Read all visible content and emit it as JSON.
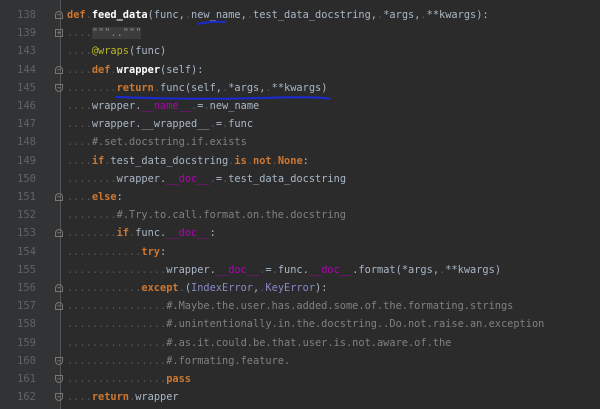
{
  "editor": {
    "colors": {
      "background": "#2b2b2b",
      "keyword": "#cc7832",
      "decorator": "#bbb529",
      "dunder": "#b200b2",
      "comment": "#808080",
      "builtin_class": "#8888c6",
      "annotation": "#1a2bd6"
    },
    "lines": [
      {
        "num": "138",
        "fold": "minus",
        "tokens": [
          [
            "kw",
            "def"
          ],
          [
            "ws",
            "."
          ],
          [
            "fn",
            "feed_data"
          ],
          [
            "tx",
            "(func,"
          ],
          [
            "ws",
            "."
          ],
          [
            "tx",
            "new_name,"
          ],
          [
            "ws",
            "."
          ],
          [
            "tx",
            "test_data_docstring,"
          ],
          [
            "ws",
            "."
          ],
          [
            "tx",
            "*args,"
          ],
          [
            "ws",
            "."
          ],
          [
            "tx",
            "**kwargs):"
          ]
        ]
      },
      {
        "num": "139",
        "fold": "plus",
        "tokens": [
          [
            "ws",
            "...."
          ],
          [
            "fold",
            "\"\"\"..\"\"\""
          ]
        ]
      },
      {
        "num": "143",
        "fold": "",
        "tokens": [
          [
            "ws",
            "...."
          ],
          [
            "dec",
            "@wraps"
          ],
          [
            "tx",
            "(func)"
          ]
        ]
      },
      {
        "num": "144",
        "fold": "minus",
        "tokens": [
          [
            "ws",
            "...."
          ],
          [
            "kw",
            "def"
          ],
          [
            "ws",
            "."
          ],
          [
            "fn",
            "wrapper"
          ],
          [
            "tx",
            "(self):"
          ]
        ]
      },
      {
        "num": "145",
        "fold": "end",
        "tokens": [
          [
            "ws",
            "........"
          ],
          [
            "kw",
            "return"
          ],
          [
            "ws",
            "."
          ],
          [
            "tx",
            "func(self,"
          ],
          [
            "ws",
            "."
          ],
          [
            "tx",
            "*args,"
          ],
          [
            "ws",
            "."
          ],
          [
            "tx",
            "**kwargs)"
          ]
        ]
      },
      {
        "num": "146",
        "fold": "",
        "tokens": [
          [
            "ws",
            "...."
          ],
          [
            "tx",
            "wrapper."
          ],
          [
            "dun",
            "__name__"
          ],
          [
            "ws",
            "."
          ],
          [
            "tx",
            "="
          ],
          [
            "ws",
            "."
          ],
          [
            "tx",
            "new_name"
          ]
        ]
      },
      {
        "num": "147",
        "fold": "",
        "tokens": [
          [
            "ws",
            "...."
          ],
          [
            "tx",
            "wrapper.__wrapped__"
          ],
          [
            "ws",
            "."
          ],
          [
            "tx",
            "="
          ],
          [
            "ws",
            "."
          ],
          [
            "tx",
            "func"
          ]
        ]
      },
      {
        "num": "148",
        "fold": "",
        "tokens": [
          [
            "ws",
            "...."
          ],
          [
            "cm",
            "#.set.docstring.if.exists"
          ]
        ]
      },
      {
        "num": "149",
        "fold": "",
        "tokens": [
          [
            "ws",
            "...."
          ],
          [
            "kw",
            "if"
          ],
          [
            "ws",
            "."
          ],
          [
            "tx",
            "test_data_docstring"
          ],
          [
            "ws",
            "."
          ],
          [
            "kw",
            "is"
          ],
          [
            "ws",
            "."
          ],
          [
            "kw",
            "not"
          ],
          [
            "ws",
            "."
          ],
          [
            "kw",
            "None"
          ],
          [
            "tx",
            ":"
          ]
        ]
      },
      {
        "num": "150",
        "fold": "",
        "tokens": [
          [
            "ws",
            "........"
          ],
          [
            "tx",
            "wrapper."
          ],
          [
            "dun",
            "__doc__"
          ],
          [
            "ws",
            "."
          ],
          [
            "tx",
            "="
          ],
          [
            "ws",
            "."
          ],
          [
            "tx",
            "test_data_docstring"
          ]
        ]
      },
      {
        "num": "151",
        "fold": "minus",
        "tokens": [
          [
            "ws",
            "...."
          ],
          [
            "kw",
            "else"
          ],
          [
            "tx",
            ":"
          ]
        ]
      },
      {
        "num": "152",
        "fold": "",
        "tokens": [
          [
            "ws",
            "........"
          ],
          [
            "cm",
            "#.Try.to.call.format.on.the.docstring"
          ]
        ]
      },
      {
        "num": "153",
        "fold": "minus",
        "tokens": [
          [
            "ws",
            "........"
          ],
          [
            "kw",
            "if"
          ],
          [
            "ws",
            "."
          ],
          [
            "tx",
            "func."
          ],
          [
            "dun",
            "__doc__"
          ],
          [
            "tx",
            ":"
          ]
        ]
      },
      {
        "num": "154",
        "fold": "",
        "tokens": [
          [
            "ws",
            "............"
          ],
          [
            "kw",
            "try"
          ],
          [
            "tx",
            ":"
          ]
        ]
      },
      {
        "num": "155",
        "fold": "",
        "tokens": [
          [
            "ws",
            "................"
          ],
          [
            "tx",
            "wrapper."
          ],
          [
            "dun",
            "__doc__"
          ],
          [
            "ws",
            "."
          ],
          [
            "tx",
            "="
          ],
          [
            "ws",
            "."
          ],
          [
            "tx",
            "func."
          ],
          [
            "dun",
            "__doc__"
          ],
          [
            "tx",
            ".format(*args,"
          ],
          [
            "ws",
            "."
          ],
          [
            "tx",
            "**kwargs)"
          ]
        ]
      },
      {
        "num": "156",
        "fold": "minus",
        "tokens": [
          [
            "ws",
            "............"
          ],
          [
            "kw",
            "except"
          ],
          [
            "ws",
            "."
          ],
          [
            "tx",
            "("
          ],
          [
            "cls",
            "IndexError"
          ],
          [
            "tx",
            ","
          ],
          [
            "ws",
            "."
          ],
          [
            "cls",
            "KeyError"
          ],
          [
            "tx",
            "):"
          ]
        ]
      },
      {
        "num": "157",
        "fold": "minus",
        "tokens": [
          [
            "ws",
            "................"
          ],
          [
            "cm",
            "#.Maybe.the.user.has.added.some.of.the.formating.strings"
          ]
        ]
      },
      {
        "num": "158",
        "fold": "",
        "tokens": [
          [
            "ws",
            "................"
          ],
          [
            "cm",
            "#.unintentionally.in.the.docstring..Do.not.raise.an.exception"
          ]
        ]
      },
      {
        "num": "159",
        "fold": "",
        "tokens": [
          [
            "ws",
            "................"
          ],
          [
            "cm",
            "#.as.it.could.be.that.user.is.not.aware.of.the"
          ]
        ]
      },
      {
        "num": "160",
        "fold": "end",
        "tokens": [
          [
            "ws",
            "................"
          ],
          [
            "cm",
            "#.formating.feature."
          ]
        ]
      },
      {
        "num": "161",
        "fold": "end",
        "tokens": [
          [
            "ws",
            "................"
          ],
          [
            "kw",
            "pass"
          ]
        ]
      },
      {
        "num": "162",
        "fold": "end",
        "tokens": [
          [
            "ws",
            "...."
          ],
          [
            "kw",
            "return"
          ],
          [
            "ws",
            "."
          ],
          [
            "tx",
            "wrapper"
          ]
        ]
      }
    ]
  }
}
